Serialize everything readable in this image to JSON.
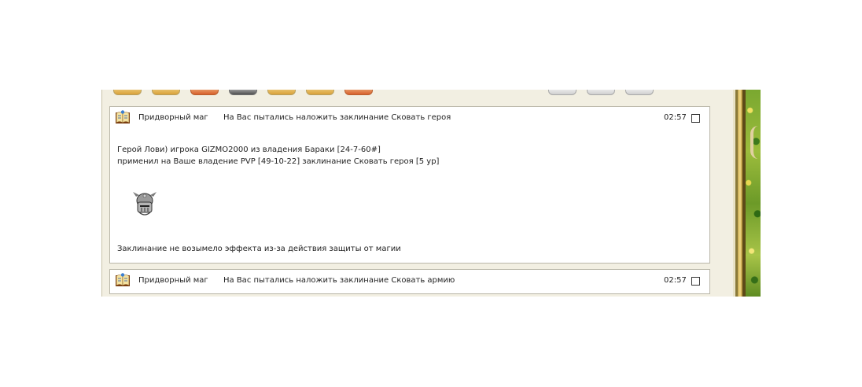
{
  "messages": [
    {
      "sender": "Придворный маг",
      "subject": "На Вас пытались наложить заклинание Сковать героя",
      "time": "02:57",
      "body": [
        "Герой Лови) игрока GIZMO2000 из владения Бараки [24-7-60#]",
        "применил на Ваше владение PVP [49-10-22] заклинание Сковать героя [5 ур]"
      ],
      "result": "Заклинание не возымело эффекта из-за действия защиты от магии"
    },
    {
      "sender": "Придворный маг",
      "subject": "На Вас пытались наложить заклинание Сковать армию",
      "time": "02:57"
    }
  ],
  "icons": {
    "sender_icon": "book-icon",
    "spell_icon": "helmet-icon",
    "select_control": "checkbox"
  },
  "colors": {
    "panel_background": "#f2efe2",
    "message_background": "#ffffff",
    "message_border": "#b9b6a8",
    "text": "#222222"
  }
}
